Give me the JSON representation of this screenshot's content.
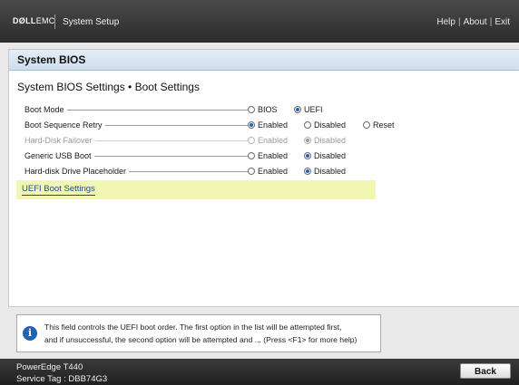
{
  "header": {
    "brand_main": "DØLL",
    "brand_suffix": "EMC",
    "app_title": "System Setup",
    "nav": {
      "help": "Help",
      "about": "About",
      "exit": "Exit",
      "separator": "|"
    }
  },
  "panel": {
    "title": "System BIOS",
    "heading": "System BIOS Settings • Boot Settings"
  },
  "settings": [
    {
      "label": "Boot Mode",
      "disabled": false,
      "options": [
        {
          "label": "BIOS",
          "selected": false
        },
        {
          "label": "UEFI",
          "selected": true
        }
      ]
    },
    {
      "label": "Boot Sequence Retry",
      "disabled": false,
      "options": [
        {
          "label": "Enabled",
          "selected": true
        },
        {
          "label": "Disabled",
          "selected": false
        },
        {
          "label": "Reset",
          "selected": false
        }
      ]
    },
    {
      "label": "Hard-Disk Failover",
      "disabled": true,
      "options": [
        {
          "label": "Enabled",
          "selected": false
        },
        {
          "label": "Disabled",
          "selected": true
        }
      ]
    },
    {
      "label": "Generic USB Boot",
      "disabled": false,
      "options": [
        {
          "label": "Enabled",
          "selected": false
        },
        {
          "label": "Disabled",
          "selected": true
        }
      ]
    },
    {
      "label": "Hard-disk Drive Placeholder",
      "disabled": false,
      "options": [
        {
          "label": "Enabled",
          "selected": false
        },
        {
          "label": "Disabled",
          "selected": true
        }
      ]
    }
  ],
  "link": {
    "label": "UEFI Boot Settings"
  },
  "help": {
    "icon": "info-icon",
    "line1": "This field controls the UEFI boot order. The first option in the list will be attempted first,",
    "line2": "and if unsuccessful, the second option will be attempted and ... (Press <F1> for more help)"
  },
  "footer": {
    "model": "PowerEdge T440",
    "service_tag": "Service Tag : DBB74G3",
    "back_label": "Back"
  },
  "colors": {
    "accent": "#1f63b3",
    "link_highlight": "#f1f7b3",
    "header_bg": "#2b2b2b"
  }
}
